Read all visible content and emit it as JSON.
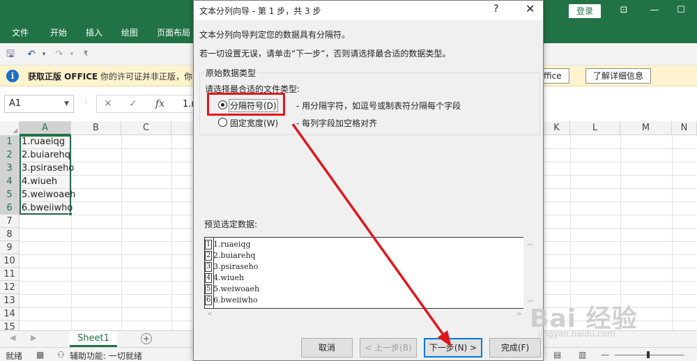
{
  "excel": {
    "login": "登录",
    "ribbon_tabs": [
      "文件",
      "开始",
      "插入",
      "绘图",
      "页面布局"
    ],
    "info": {
      "title": "获取正版 OFFICE",
      "text": "你的许可证并非正版，你",
      "partial_button": "ffice",
      "learn_more": "了解详细信息"
    },
    "namebox": "A1",
    "formula_partial": "1.r",
    "fx": "fx",
    "columns_left": [
      "A",
      "B",
      "C"
    ],
    "columns_right": [
      "K",
      "L",
      "M",
      "N"
    ],
    "rows": [
      "1",
      "2",
      "3",
      "4",
      "5",
      "6",
      "7",
      "8",
      "9",
      "10",
      "11",
      "12",
      "13",
      "14",
      "15"
    ],
    "cells": [
      "1.ruaeiqg",
      "2.buiarehq",
      "3.psiraseho",
      "4.wiueh",
      "5.weiwoaeh",
      "6.bweiiwho"
    ],
    "sheet_tab": "Sheet1",
    "status": {
      "ready": "就绪",
      "accessibility": "辅助功能: 一切就绪"
    }
  },
  "dialog": {
    "title": "文本分列向导 - 第 1 步，共 3 步",
    "help": "?",
    "close": "✕",
    "line1": "文本分列向导判定您的数据具有分隔符。",
    "line2": "若一切设置无误，请单击“下一步”，否则请选择最合适的数据类型。",
    "group_label": "原始数据类型",
    "choose_label": "请选择最合适的文件类型:",
    "option_delimited": "分隔符号(D)",
    "option_delimited_desc": "- 用分隔字符，如逗号或制表符分隔每个字段",
    "option_fixed": "固定宽度(W)",
    "option_fixed_desc": "- 每列字段加空格对齐",
    "preview_label": "预览选定数据:",
    "preview_rows": [
      {
        "num": "1",
        "text": "1.ruaeiqg"
      },
      {
        "num": "2",
        "text": "2.buiarehq"
      },
      {
        "num": "3",
        "text": "3.psiraseho"
      },
      {
        "num": "4",
        "text": "4.wiueh"
      },
      {
        "num": "5",
        "text": "5.weiwoaeh"
      },
      {
        "num": "6",
        "text": "6.bweiiwho"
      }
    ],
    "buttons": {
      "cancel": "取消",
      "back": "< 上一步(B)",
      "next": "下一步(N) >",
      "finish": "完成(F)"
    }
  },
  "watermark": {
    "main": "Bai 经验",
    "sub": "jingyan.baidu.com"
  },
  "colors": {
    "excel_green": "#217346",
    "annotation_red": "#e0161c",
    "focus_blue": "#0078d7"
  }
}
